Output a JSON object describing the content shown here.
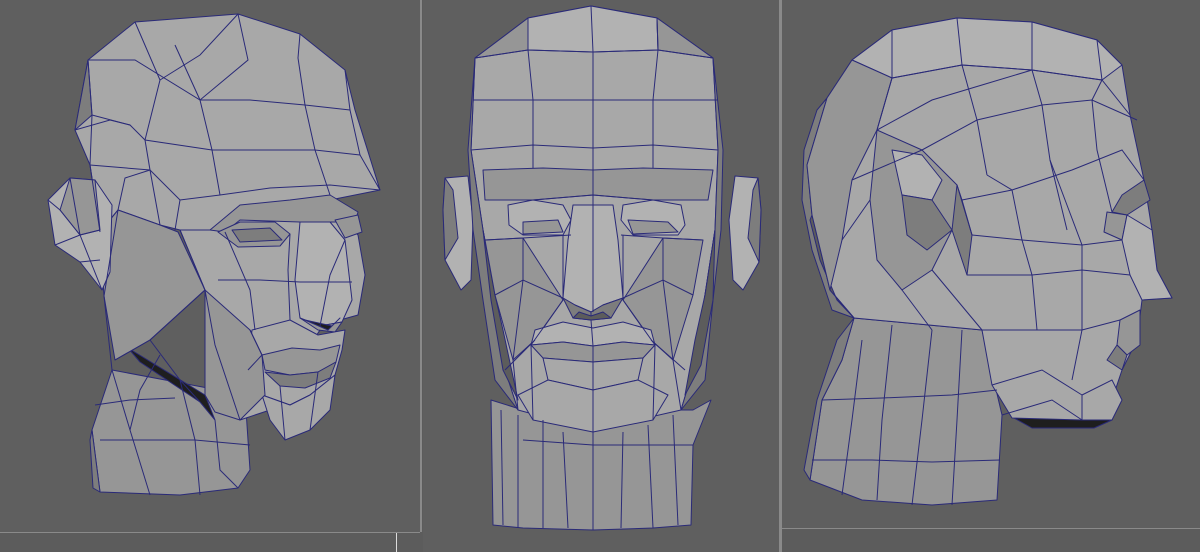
{
  "viewports": [
    {
      "id": "persp",
      "view": "perspective",
      "object": "head-mesh"
    },
    {
      "id": "front",
      "view": "front",
      "object": "head-mesh"
    },
    {
      "id": "side",
      "view": "side",
      "object": "head-mesh"
    }
  ],
  "colors": {
    "viewport_background": "#5f5f5f",
    "mesh_shade_light": "#a8a8a8",
    "mesh_shade_mid": "#969696",
    "mesh_shade_dark": "#7d7d7d",
    "wireframe": "#2a2a78"
  }
}
